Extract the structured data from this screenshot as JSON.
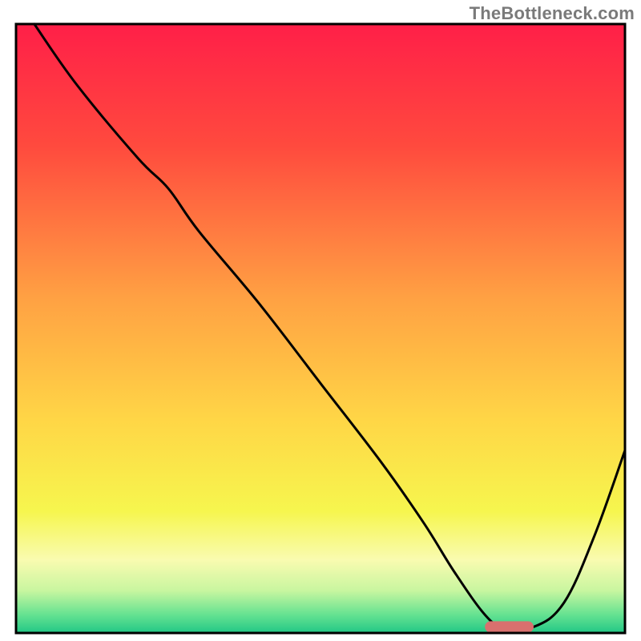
{
  "watermark": "TheBottleneck.com",
  "chart_data": {
    "type": "line",
    "title": "",
    "xlabel": "",
    "ylabel": "",
    "xlim": [
      0,
      100
    ],
    "ylim": [
      0,
      100
    ],
    "x": [
      3,
      10,
      20,
      25,
      30,
      40,
      50,
      60,
      67,
      72,
      77,
      80,
      85,
      90,
      95,
      100
    ],
    "values": [
      100,
      90,
      78,
      73,
      66,
      54,
      41,
      28,
      18,
      10,
      3,
      1,
      1,
      5,
      16,
      30
    ],
    "minimum_marker": {
      "x_start": 77,
      "x_end": 85,
      "y": 1
    },
    "gradient_stops": [
      {
        "pct": 0,
        "color": "#ff1f48"
      },
      {
        "pct": 20,
        "color": "#ff4a3e"
      },
      {
        "pct": 45,
        "color": "#ffa143"
      },
      {
        "pct": 65,
        "color": "#ffd646"
      },
      {
        "pct": 80,
        "color": "#f6f64e"
      },
      {
        "pct": 88,
        "color": "#f9fbb0"
      },
      {
        "pct": 93,
        "color": "#c9f6a0"
      },
      {
        "pct": 97,
        "color": "#65e291"
      },
      {
        "pct": 100,
        "color": "#22c786"
      }
    ],
    "marker_color": "#d9706e",
    "frame_color": "#000000"
  }
}
